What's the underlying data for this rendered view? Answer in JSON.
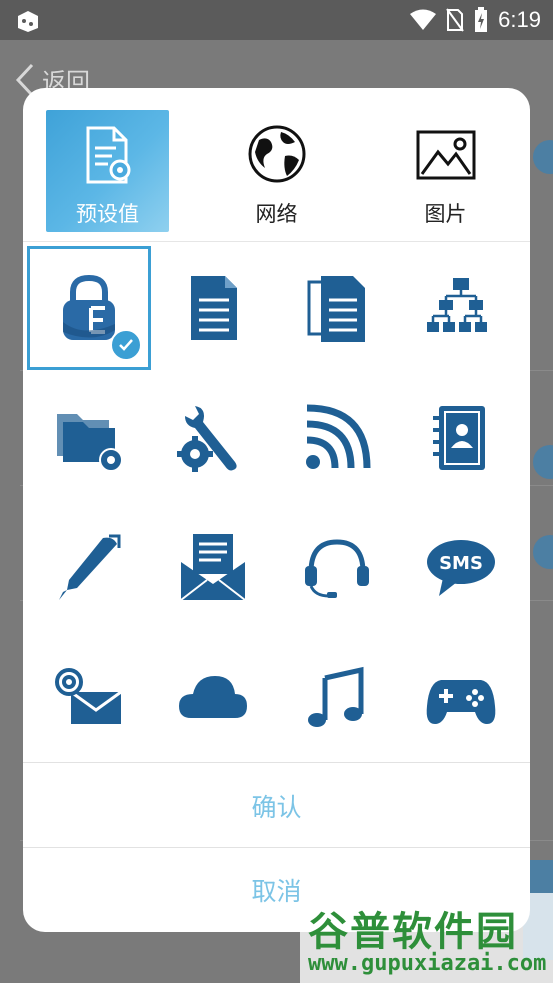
{
  "status_bar": {
    "time": "6:19"
  },
  "background": {
    "back_label": "返回"
  },
  "dialog": {
    "tabs": [
      {
        "label": "预设值",
        "icon": "document-gear-icon",
        "active": true
      },
      {
        "label": "网络",
        "icon": "globe-icon",
        "active": false
      },
      {
        "label": "图片",
        "icon": "image-icon",
        "active": false
      }
    ],
    "icon_grid": [
      {
        "icon": "padlock-icon",
        "selected": true
      },
      {
        "icon": "document-icon"
      },
      {
        "icon": "documents-icon"
      },
      {
        "icon": "org-chart-icon"
      },
      {
        "icon": "folder-gear-icon"
      },
      {
        "icon": "wrench-gear-icon"
      },
      {
        "icon": "rss-icon"
      },
      {
        "icon": "address-book-icon"
      },
      {
        "icon": "pen-icon"
      },
      {
        "icon": "newsletter-envelope-icon"
      },
      {
        "icon": "headset-icon"
      },
      {
        "icon": "sms-bubble-icon",
        "text": "SMS"
      },
      {
        "icon": "email-at-icon"
      },
      {
        "icon": "cloud-icon"
      },
      {
        "icon": "music-note-icon"
      },
      {
        "icon": "gamepad-icon"
      }
    ],
    "confirm_label": "确认",
    "cancel_label": "取消"
  },
  "watermark": {
    "title": "谷普软件园",
    "url": "www.gupuxiazai.com"
  },
  "colors": {
    "icon_blue": "#1f5f94",
    "accent": "#3b9fd4",
    "action_text": "#7cc4e6"
  }
}
